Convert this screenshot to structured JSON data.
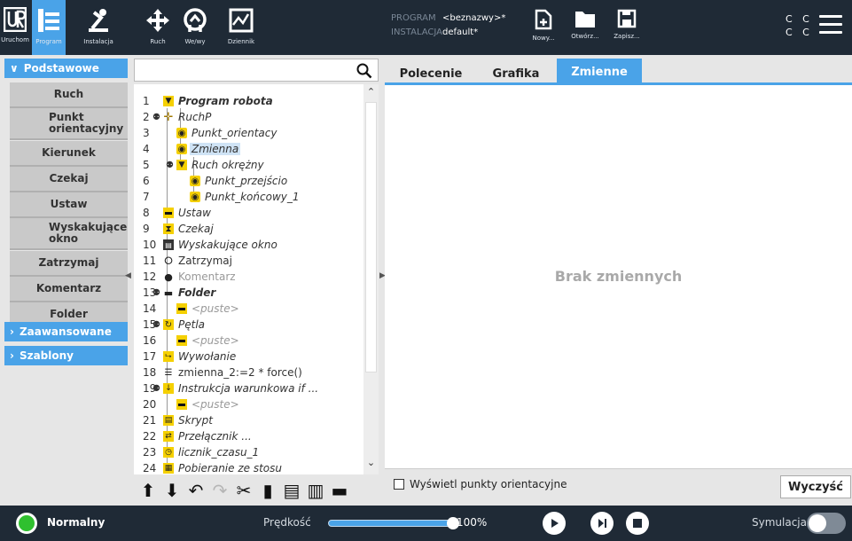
{
  "topbar": {
    "logo_label": "Uruchom",
    "nav": [
      {
        "label": "Program",
        "icon": "program-icon"
      },
      {
        "label": "Instalacja",
        "icon": "installation-icon"
      },
      {
        "label": "Ruch",
        "icon": "move-icon"
      },
      {
        "label": "We/wy",
        "icon": "io-icon"
      },
      {
        "label": "Dziennik",
        "icon": "log-icon"
      }
    ],
    "program_key": "PROGRAM",
    "program_value": "<beznazwy>*",
    "installation_key": "INSTALACJA",
    "installation_value": "default*",
    "file_buttons": [
      {
        "label": "Nowy...",
        "icon": "new-file-icon"
      },
      {
        "label": "Otwórz...",
        "icon": "folder-icon"
      },
      {
        "label": "Zapisz...",
        "icon": "save-icon"
      }
    ],
    "cc_line1": "C C",
    "cc_line2": "C C"
  },
  "sidebar": {
    "categories": [
      {
        "label": "Podstawowe",
        "expanded": true
      },
      {
        "label": "Zaawansowane",
        "expanded": false
      },
      {
        "label": "Szablony",
        "expanded": false
      }
    ],
    "basic_items": [
      "Ruch",
      "Punkt orientacyjny",
      "Kierunek",
      "Czekaj",
      "Ustaw",
      "Wyskakujące okno",
      "Zatrzymaj",
      "Komentarz",
      "Folder"
    ]
  },
  "search": {
    "placeholder": ""
  },
  "tree": [
    {
      "n": "1",
      "text": "Program robota",
      "icon": "collapse-triangle-icon",
      "style": "bold"
    },
    {
      "n": "2",
      "text": "RuchP",
      "icon": "move-cross-icon",
      "style": "italic"
    },
    {
      "n": "3",
      "text": "Punkt_orientacy",
      "icon": "waypoint-icon",
      "style": "italic"
    },
    {
      "n": "4",
      "text": "Zmienna",
      "icon": "waypoint-icon",
      "style": "selected"
    },
    {
      "n": "5",
      "text": "Ruch okrężny",
      "icon": "collapse-triangle-icon",
      "style": "italic"
    },
    {
      "n": "6",
      "text": "Punkt_przejścio",
      "icon": "waypoint-icon",
      "style": "italic"
    },
    {
      "n": "7",
      "text": "Punkt_końcowy_1",
      "icon": "waypoint-icon",
      "style": "italic"
    },
    {
      "n": "8",
      "text": "Ustaw",
      "icon": "set-icon",
      "style": "italic"
    },
    {
      "n": "9",
      "text": "Czekaj",
      "icon": "hourglass-icon",
      "style": "italic"
    },
    {
      "n": "10",
      "text": "Wyskakujące okno",
      "icon": "popup-icon",
      "style": "italic"
    },
    {
      "n": "11",
      "text": "Zatrzymaj",
      "icon": "halt-icon",
      "style": "plain"
    },
    {
      "n": "12",
      "text": "Komentarz",
      "icon": "comment-icon",
      "style": "grey"
    },
    {
      "n": "13",
      "text": "Folder",
      "icon": "folder-icon",
      "style": "bold"
    },
    {
      "n": "14",
      "text": "<puste>",
      "icon": "empty-icon",
      "style": "grey"
    },
    {
      "n": "15",
      "text": "Pętla",
      "icon": "loop-icon",
      "style": "italic"
    },
    {
      "n": "16",
      "text": "<puste>",
      "icon": "empty-icon",
      "style": "grey"
    },
    {
      "n": "17",
      "text": "Wywołanie",
      "icon": "call-icon",
      "style": "italic"
    },
    {
      "n": "18",
      "text": "zmienna_2:=2 * force()",
      "icon": "assignment-icon",
      "style": "plain"
    },
    {
      "n": "19",
      "text": "Instrukcja warunkowa if ...",
      "icon": "if-icon",
      "style": "italic"
    },
    {
      "n": "20",
      "text": "<puste>",
      "icon": "empty-icon",
      "style": "grey"
    },
    {
      "n": "21",
      "text": "Skrypt",
      "icon": "script-icon",
      "style": "italic"
    },
    {
      "n": "22",
      "text": "Przełącznik ...",
      "icon": "switch-icon",
      "style": "italic"
    },
    {
      "n": "23",
      "text": "licznik_czasu_1",
      "icon": "timer-icon",
      "style": "italic"
    },
    {
      "n": "24",
      "text": "Pobieranie ze stosu",
      "icon": "pallet-icon",
      "style": "italic"
    }
  ],
  "toolbar": [
    "move-up-icon",
    "move-down-icon",
    "undo-icon",
    "redo-icon",
    "cut-icon",
    "copy-icon",
    "paste-icon",
    "delete-icon",
    "suppress-icon"
  ],
  "right": {
    "tabs": [
      "Polecenie",
      "Grafika",
      "Zmienne"
    ],
    "active_tab": "Zmienne",
    "empty_message": "Brak zmiennych",
    "show_waypoints_label": "Wyświetl punkty orientacyjne",
    "clear_label": "Wyczyść"
  },
  "footer": {
    "status": "Normalny",
    "status_color": "#2fc02f",
    "speed_label": "Prędkość",
    "speed_value": "100%",
    "speed_fraction": 1.0,
    "simulation_label": "Symulacja",
    "simulation_on": false
  },
  "colors": {
    "accent": "#4aa3e8",
    "dark": "#1f2a36",
    "highlight": "#f5d000"
  }
}
